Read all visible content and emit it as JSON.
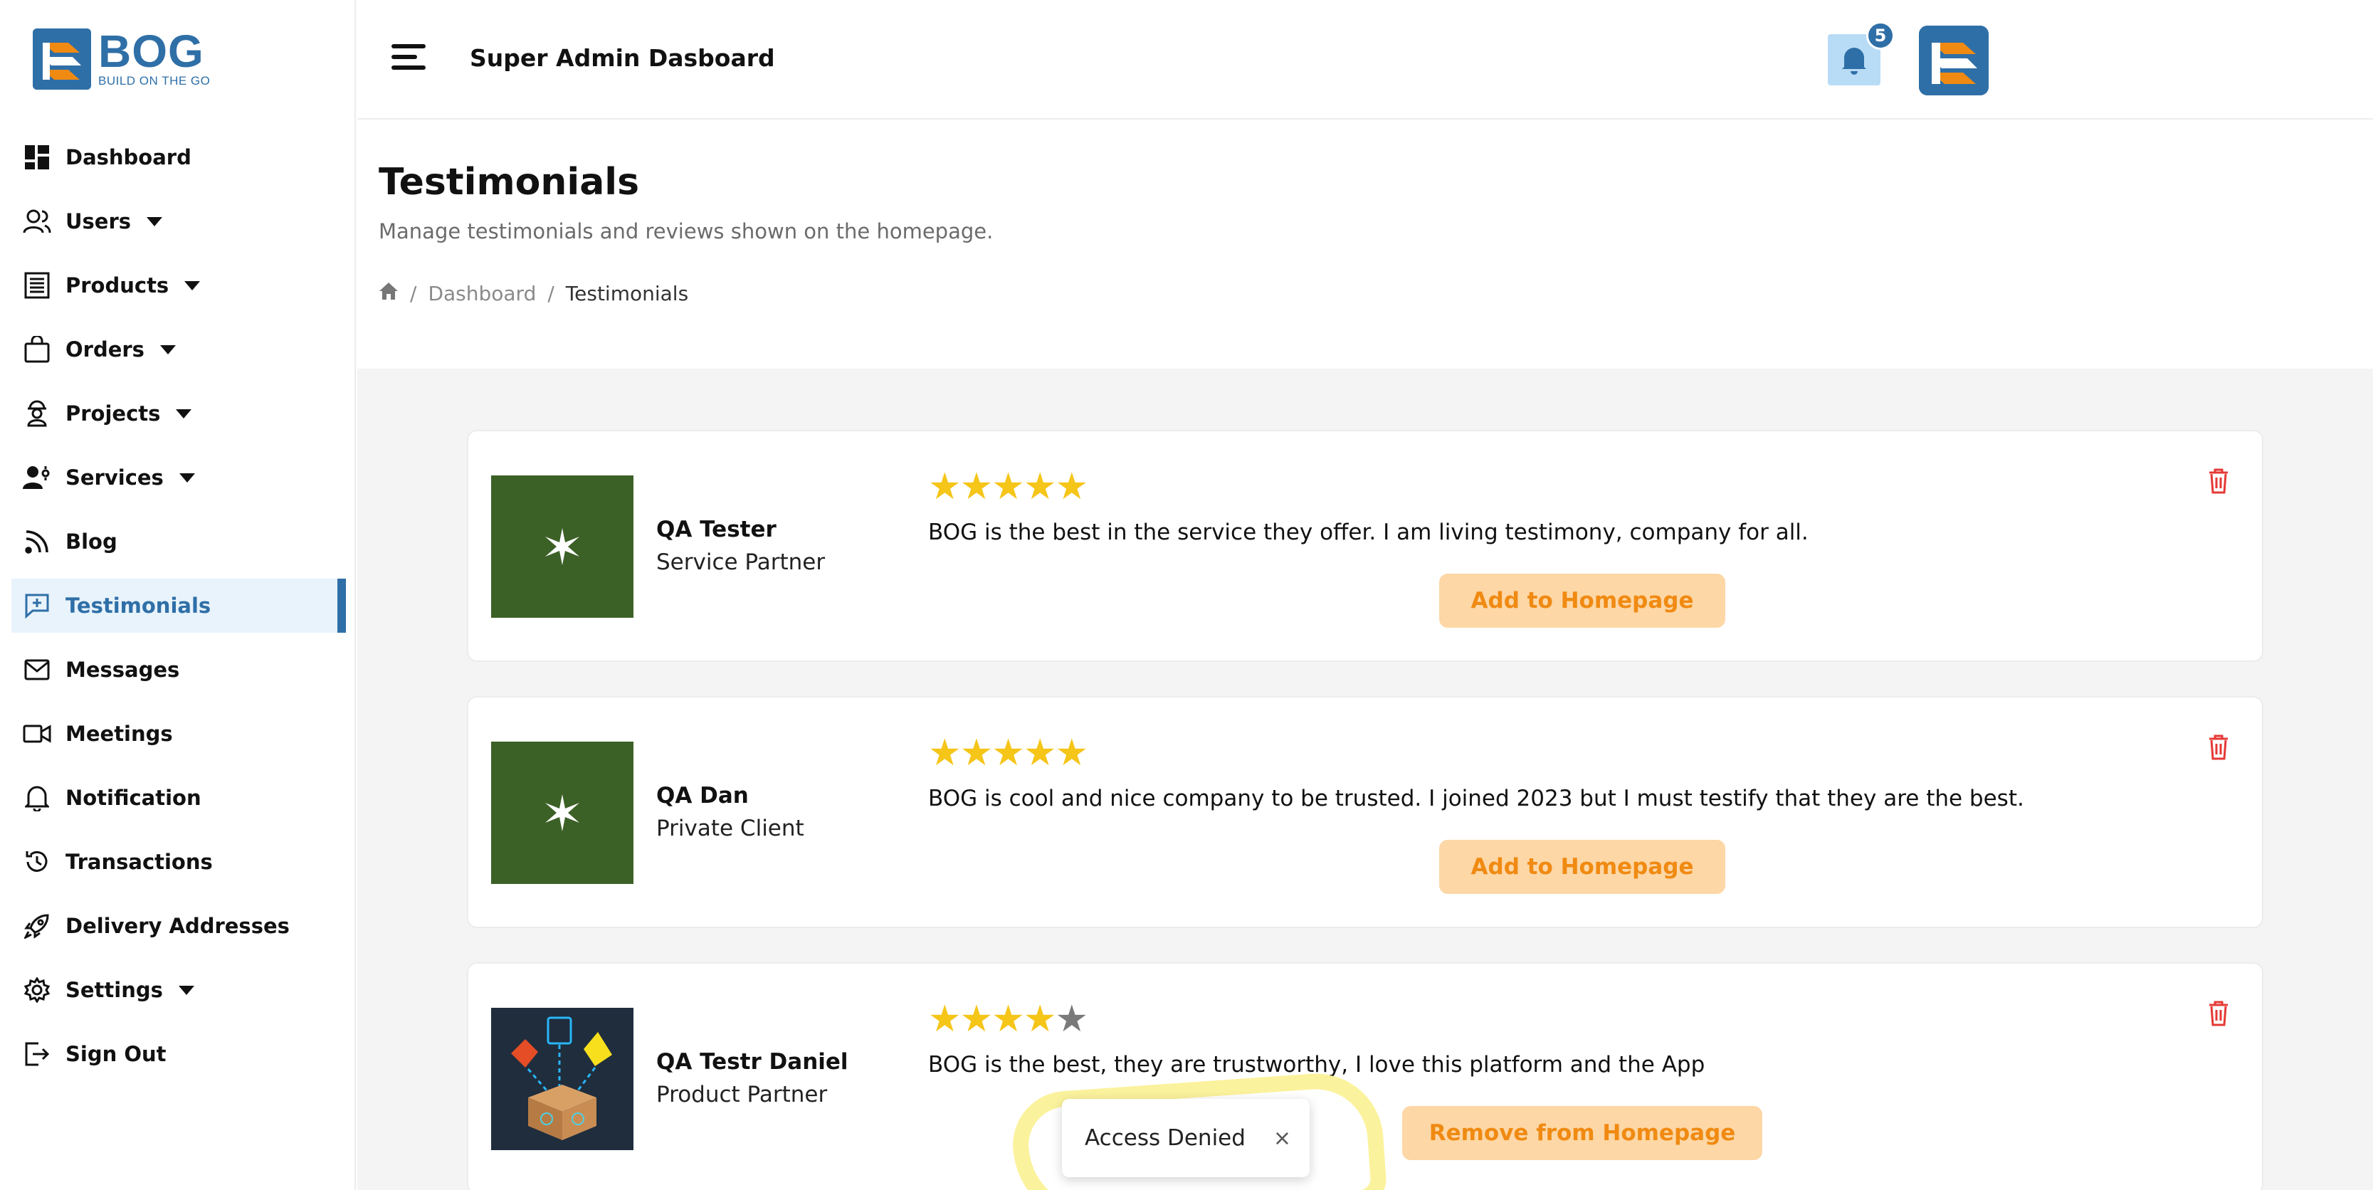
{
  "brand": {
    "name": "BOG",
    "tagline": "BUILD ON THE GO",
    "primary_color": "#2f6fa7",
    "accent_color": "#f08a12"
  },
  "sidebar": {
    "items": [
      {
        "label": "Dashboard",
        "icon": "dashboard-icon",
        "has_caret": false
      },
      {
        "label": "Users",
        "icon": "users-icon",
        "has_caret": true
      },
      {
        "label": "Products",
        "icon": "products-icon",
        "has_caret": true
      },
      {
        "label": "Orders",
        "icon": "bag-icon",
        "has_caret": true
      },
      {
        "label": "Projects",
        "icon": "worker-icon",
        "has_caret": true
      },
      {
        "label": "Services",
        "icon": "services-icon",
        "has_caret": true
      },
      {
        "label": "Blog",
        "icon": "rss-icon",
        "has_caret": false
      },
      {
        "label": "Testimonials",
        "icon": "testimonial-icon",
        "has_caret": false,
        "active": true
      },
      {
        "label": "Messages",
        "icon": "mail-icon",
        "has_caret": false
      },
      {
        "label": "Meetings",
        "icon": "video-icon",
        "has_caret": false
      },
      {
        "label": "Notification",
        "icon": "bell-icon",
        "has_caret": false
      },
      {
        "label": "Transactions",
        "icon": "history-icon",
        "has_caret": false
      },
      {
        "label": "Delivery Addresses",
        "icon": "rocket-icon",
        "has_caret": false
      },
      {
        "label": "Settings",
        "icon": "gear-icon",
        "has_caret": true
      },
      {
        "label": "Sign Out",
        "icon": "signout-icon",
        "has_caret": false
      }
    ]
  },
  "header": {
    "title": "Super Admin Dasboard",
    "notification_count": "5"
  },
  "page": {
    "title": "Testimonials",
    "subtitle": "Manage testimonials and reviews shown on the homepage.",
    "breadcrumb": {
      "home_icon": "home-icon",
      "parent": "Dashboard",
      "sep": "/",
      "current": "Testimonials"
    }
  },
  "testimonials": [
    {
      "name": "QA Tester",
      "role": "Service Partner",
      "rating": 5,
      "stars": "★★★★★",
      "stars_off": "",
      "text": "BOG is the best in the service they offer. I am living testimony, company for all.",
      "action": "Add to Homepage"
    },
    {
      "name": "QA Dan",
      "role": "Private Client",
      "rating": 5,
      "stars": "★★★★★",
      "stars_off": "",
      "text": "BOG is cool and nice company to be trusted. I joined 2023 but I must testify that they are the best.",
      "action": "Add to Homepage"
    },
    {
      "name": "QA Testr Daniel",
      "role": "Product Partner",
      "rating": 4,
      "stars": "★★★★",
      "stars_off": "★",
      "text": "BOG is the best, they are trustworthy, I love this platform and the App",
      "action": "Remove from Homepage"
    }
  ],
  "toast": {
    "message": "Access Denied",
    "close": "×"
  }
}
